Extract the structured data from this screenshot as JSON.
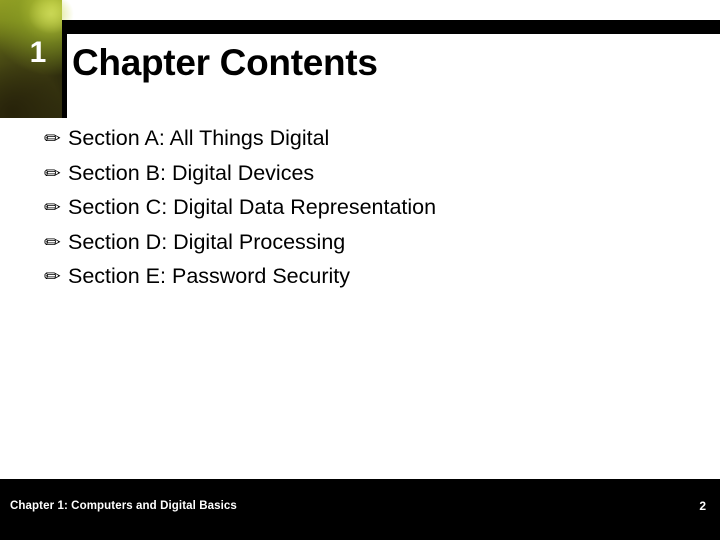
{
  "slide": {
    "chapter_number": "1",
    "title": "Chapter Contents",
    "bullet_marker": "✏",
    "bullets": [
      {
        "marker": "✏",
        "text": "Section A: All Things Digital"
      },
      {
        "marker": "✏",
        "text": "Section B: Digital Devices"
      },
      {
        "marker": "✏",
        "text": "Section C: Digital Data Representation"
      },
      {
        "marker": "✏",
        "text": "Section D: Digital Processing"
      },
      {
        "marker": "✏",
        "text": "Section E: Password Security"
      }
    ],
    "footer": {
      "text": "Chapter 1: Computers and Digital Basics",
      "page_number": "2"
    },
    "colors": {
      "background": "#ffffff",
      "bar": "#000000",
      "text": "#000000",
      "footer_text": "#ffffff",
      "number_text": "#ffffff"
    }
  }
}
